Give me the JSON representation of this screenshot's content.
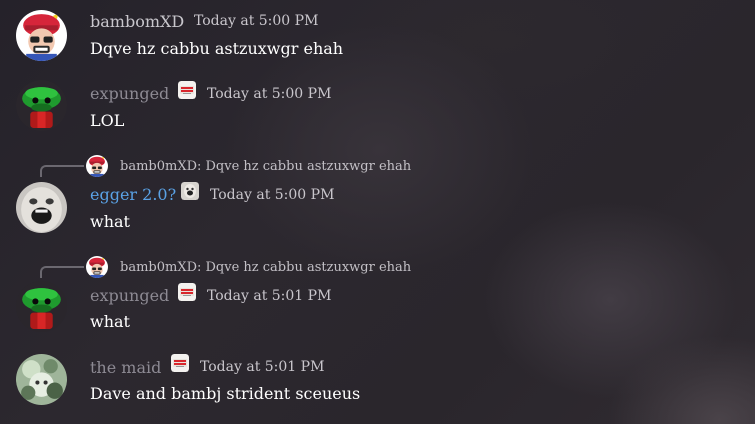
{
  "messages": [
    {
      "author": "bambomXD",
      "timestamp": "Today at 5:00 PM",
      "text": "Dqve hz cabbu astzuxwgr  ehah",
      "avatar": "bambi-avatar"
    },
    {
      "author": "expunged",
      "badge": "sticker-badge-icon",
      "timestamp": "Today at 5:00 PM",
      "text": "LOL",
      "avatar": "frog-avatar"
    },
    {
      "reply": {
        "text": "bamb0mXD: Dqve hz cabbu astzuxwgr  ehah"
      },
      "author": "egger 2.0?",
      "badge": "egg-badge-icon",
      "timestamp": "Today at 5:00 PM",
      "text": "what",
      "avatar": "egg-face-avatar"
    },
    {
      "reply": {
        "text": "bamb0mXD: Dqve hz cabbu astzuxwgr  ehah"
      },
      "author": "expunged",
      "badge": "sticker-badge-icon",
      "timestamp": "Today at 5:01 PM",
      "text": "what",
      "avatar": "frog-avatar"
    },
    {
      "author": "the maid",
      "badge": "sticker-badge-icon",
      "timestamp": "Today at 5:01 PM",
      "text": "Dave and bambj strident sceueus",
      "avatar": "maid-avatar"
    }
  ],
  "colors": {
    "egger_name": "#5aa2e6",
    "muted_name": "#8d8a93",
    "message_text": "#ffffff",
    "timestamp": "#c9c6cc"
  }
}
